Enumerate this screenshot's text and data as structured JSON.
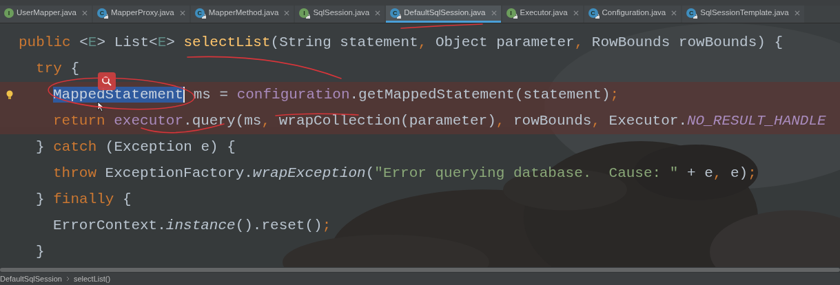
{
  "tabs": [
    {
      "label": "UserMapper.java",
      "kind": "interface",
      "badge": "I",
      "locked": false,
      "selected": false
    },
    {
      "label": "MapperProxy.java",
      "kind": "class",
      "badge": "C",
      "locked": true,
      "selected": false
    },
    {
      "label": "MapperMethod.java",
      "kind": "class",
      "badge": "C",
      "locked": true,
      "selected": false
    },
    {
      "label": "SqlSession.java",
      "kind": "interface",
      "badge": "I",
      "locked": true,
      "selected": false
    },
    {
      "label": "DefaultSqlSession.java",
      "kind": "class",
      "badge": "C",
      "locked": true,
      "selected": true
    },
    {
      "label": "Executor.java",
      "kind": "interface",
      "badge": "I",
      "locked": true,
      "selected": false
    },
    {
      "label": "Configuration.java",
      "kind": "class",
      "badge": "C",
      "locked": true,
      "selected": false
    },
    {
      "label": "SqlSessionTemplate.java",
      "kind": "class",
      "badge": "C",
      "locked": true,
      "selected": false
    }
  ],
  "editor": {
    "lines": [
      {
        "highlighted": false,
        "bulb": false,
        "tokens": [
          {
            "text": "public",
            "kind": "keyword"
          },
          {
            "text": " <",
            "kind": "plain"
          },
          {
            "text": "E",
            "kind": "type_param"
          },
          {
            "text": "> List<",
            "kind": "plain"
          },
          {
            "text": "E",
            "kind": "type_param"
          },
          {
            "text": "> ",
            "kind": "plain"
          },
          {
            "text": "selectList",
            "kind": "declaration"
          },
          {
            "text": "(String statement",
            "kind": "plain"
          },
          {
            "text": ",",
            "kind": "punct"
          },
          {
            "text": " Object parameter",
            "kind": "plain"
          },
          {
            "text": ",",
            "kind": "punct"
          },
          {
            "text": " RowBounds rowBounds) {",
            "kind": "plain"
          }
        ],
        "children": [
          {
            "highlighted": false,
            "bulb": false,
            "tokens": [
              {
                "text": "try",
                "kind": "keyword"
              },
              {
                "text": " {",
                "kind": "plain"
              }
            ],
            "children": [
              {
                "highlighted": true,
                "bulb": true,
                "tokens": [
                  {
                    "text": "MappedStatement",
                    "kind": "selection"
                  },
                  {
                    "text": " ms = ",
                    "kind": "plain"
                  },
                  {
                    "text": "configuration",
                    "kind": "field"
                  },
                  {
                    "text": ".getMappedStatement(statement)",
                    "kind": "plain"
                  },
                  {
                    "text": ";",
                    "kind": "punct"
                  }
                ]
              },
              {
                "highlighted": true,
                "bulb": false,
                "tokens": [
                  {
                    "text": "return ",
                    "kind": "keyword"
                  },
                  {
                    "text": "executor",
                    "kind": "field"
                  },
                  {
                    "text": ".query(ms",
                    "kind": "plain"
                  },
                  {
                    "text": ",",
                    "kind": "punct"
                  },
                  {
                    "text": " wrapCollection(parameter)",
                    "kind": "plain"
                  },
                  {
                    "text": ",",
                    "kind": "punct"
                  },
                  {
                    "text": " rowBounds",
                    "kind": "plain"
                  },
                  {
                    "text": ",",
                    "kind": "punct"
                  },
                  {
                    "text": " Executor.",
                    "kind": "plain"
                  },
                  {
                    "text": "NO_RESULT_HANDLE",
                    "kind": "constant"
                  }
                ]
              }
            ]
          },
          {
            "highlighted": false,
            "bulb": false,
            "tokens": [
              {
                "text": "} ",
                "kind": "plain"
              },
              {
                "text": "catch",
                "kind": "keyword"
              },
              {
                "text": " (Exception e) {",
                "kind": "plain"
              }
            ],
            "children": [
              {
                "highlighted": false,
                "bulb": false,
                "tokens": [
                  {
                    "text": "throw",
                    "kind": "keyword"
                  },
                  {
                    "text": " ExceptionFactory.",
                    "kind": "plain"
                  },
                  {
                    "text": "wrapException",
                    "kind": "static"
                  },
                  {
                    "text": "(",
                    "kind": "plain"
                  },
                  {
                    "text": "\"Error querying database.  Cause: \"",
                    "kind": "string"
                  },
                  {
                    "text": " + e",
                    "kind": "plain"
                  },
                  {
                    "text": ",",
                    "kind": "punct"
                  },
                  {
                    "text": " e)",
                    "kind": "plain"
                  },
                  {
                    "text": ";",
                    "kind": "punct"
                  }
                ]
              }
            ]
          },
          {
            "highlighted": false,
            "bulb": false,
            "tokens": [
              {
                "text": "} ",
                "kind": "plain"
              },
              {
                "text": "finally",
                "kind": "keyword"
              },
              {
                "text": " {",
                "kind": "plain"
              }
            ],
            "children": [
              {
                "highlighted": false,
                "bulb": false,
                "tokens": [
                  {
                    "text": "ErrorContext.",
                    "kind": "plain"
                  },
                  {
                    "text": "instance",
                    "kind": "static"
                  },
                  {
                    "text": "().reset()",
                    "kind": "plain"
                  },
                  {
                    "text": ";",
                    "kind": "punct"
                  }
                ]
              }
            ]
          },
          {
            "highlighted": false,
            "bulb": false,
            "tokens": [
              {
                "text": "}",
                "kind": "plain"
              }
            ]
          }
        ]
      }
    ]
  },
  "breadcrumb": [
    "DefaultSqlSession",
    "selectList()"
  ]
}
